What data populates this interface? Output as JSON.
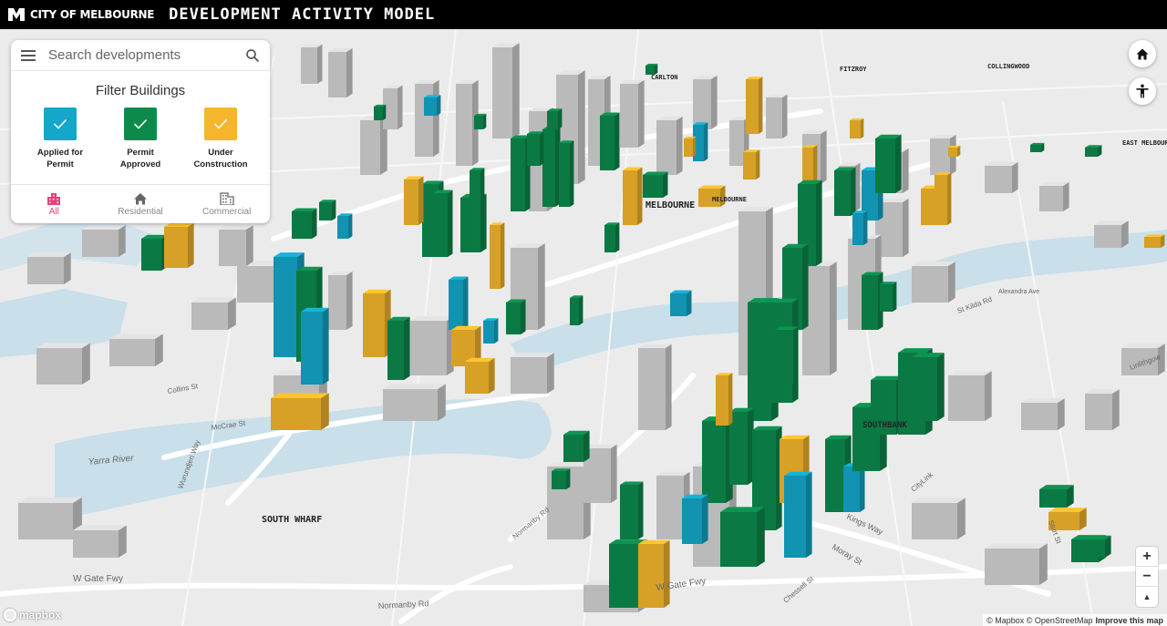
{
  "header": {
    "logo_text": "CITY OF MELBOURNE",
    "app_title": "DEVELOPMENT ACTIVITY MODEL"
  },
  "search": {
    "placeholder": "Search developments"
  },
  "filter_panel": {
    "title": "Filter Buildings",
    "filters": [
      {
        "line1": "Applied for",
        "line2": "Permit",
        "color": "#13a7c9",
        "checked": true
      },
      {
        "line1": "Permit",
        "line2": "Approved",
        "color": "#0c8a4c",
        "checked": true
      },
      {
        "line1": "Under",
        "line2": "Construction",
        "color": "#f4b62c",
        "checked": true
      }
    ],
    "tabs": [
      {
        "label": "All",
        "icon": "buildings-icon",
        "active": true
      },
      {
        "label": "Residential",
        "icon": "home-icon",
        "active": false
      },
      {
        "label": "Commercial",
        "icon": "office-building-icon",
        "active": false
      }
    ]
  },
  "map": {
    "place_labels": [
      "CARLTON",
      "FITZROY",
      "COLLINGWOOD",
      "EAST MELBOURNE",
      "MELBOURNE",
      "MELBOURNE",
      "SOUTHBANK",
      "SOUTH WHARF"
    ],
    "road_labels": [
      "Yarra River",
      "Collins St",
      "McCrae St",
      "Wurundjeri Way",
      "W Gate Fwy",
      "W Gate Fwy",
      "Normanby Rd",
      "Normanby Rd",
      "Kings Way",
      "Moray St",
      "CityLink",
      "Chessell St",
      "Sturt St",
      "St Kilda Rd",
      "Alexandra Ave",
      "Linlithgow"
    ],
    "controls": {
      "zoom_in": "+",
      "zoom_out": "−",
      "compass": "▲"
    }
  },
  "footer": {
    "mapbox": "mapbox",
    "attribution": "© Mapbox © OpenStreetMap",
    "improve": "Improve this map"
  },
  "colors": {
    "applied": "#13a7c9",
    "approved": "#0c8a4c",
    "construction": "#f4b62c",
    "water": "#c6dde9",
    "accent": "#e6427f"
  }
}
